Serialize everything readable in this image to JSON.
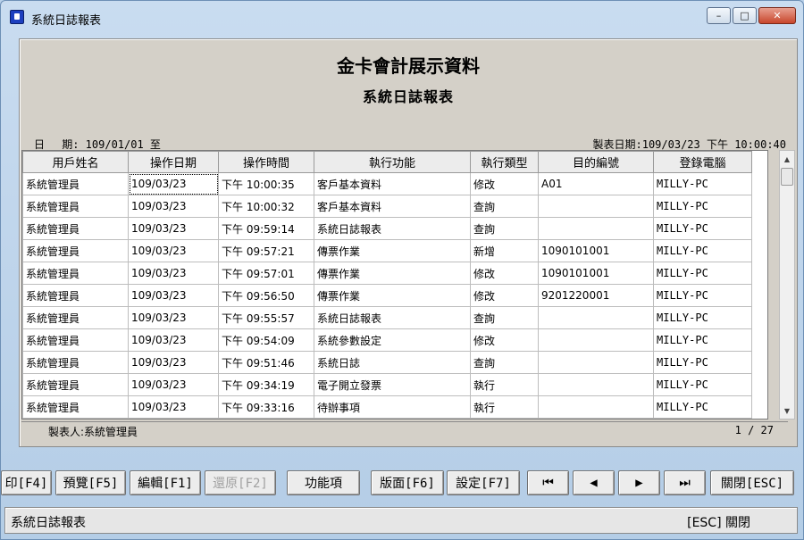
{
  "window": {
    "title": "系統日誌報表",
    "minimize_label": "–",
    "maximize_label": "□",
    "close_label": "✕"
  },
  "report": {
    "company": "金卡會計展示資料",
    "name": "系統日誌報表",
    "date_range": "日　 期: 109/01/01 至",
    "print_date": "製表日期:109/03/23 下午 10:00:40",
    "preparer": "製表人:系統管理員",
    "page": "1 / 27"
  },
  "table": {
    "columns": [
      "用戶姓名",
      "操作日期",
      "操作時間",
      "執行功能",
      "執行類型",
      "目的編號",
      "登錄電腦"
    ],
    "rows": [
      [
        "系統管理員",
        "109/03/23",
        "下午 10:00:35",
        "客戶基本資料",
        "修改",
        "A01",
        "MILLY-PC"
      ],
      [
        "系統管理員",
        "109/03/23",
        "下午 10:00:32",
        "客戶基本資料",
        "查詢",
        "",
        "MILLY-PC"
      ],
      [
        "系統管理員",
        "109/03/23",
        "下午 09:59:14",
        "系統日誌報表",
        "查詢",
        "",
        "MILLY-PC"
      ],
      [
        "系統管理員",
        "109/03/23",
        "下午 09:57:21",
        "傳票作業",
        "新增",
        "1090101001",
        "MILLY-PC"
      ],
      [
        "系統管理員",
        "109/03/23",
        "下午 09:57:01",
        "傳票作業",
        "修改",
        "1090101001",
        "MILLY-PC"
      ],
      [
        "系統管理員",
        "109/03/23",
        "下午 09:56:50",
        "傳票作業",
        "修改",
        "9201220001",
        "MILLY-PC"
      ],
      [
        "系統管理員",
        "109/03/23",
        "下午 09:55:57",
        "系統日誌報表",
        "查詢",
        "",
        "MILLY-PC"
      ],
      [
        "系統管理員",
        "109/03/23",
        "下午 09:54:09",
        "系統參數設定",
        "修改",
        "",
        "MILLY-PC"
      ],
      [
        "系統管理員",
        "109/03/23",
        "下午 09:51:46",
        "系統日誌",
        "查詢",
        "",
        "MILLY-PC"
      ],
      [
        "系統管理員",
        "109/03/23",
        "下午 09:34:19",
        "電子開立發票",
        "執行",
        "",
        "MILLY-PC"
      ],
      [
        "系統管理員",
        "109/03/23",
        "下午 09:33:16",
        "待辦事項",
        "執行",
        "",
        "MILLY-PC"
      ],
      [
        "",
        "",
        "",
        "",
        "",
        "",
        ""
      ]
    ]
  },
  "toolbar": {
    "print": "印[F4]",
    "preview": "預覽[F5]",
    "edit": "編輯[F1]",
    "restore": "還原[F2]",
    "functions": "功能項",
    "layout": "版面[F6]",
    "settings": "設定[F7]",
    "first": "⏮",
    "prev": "◀",
    "next": "▶",
    "last": "⏭",
    "close": "關閉[ESC]"
  },
  "status": {
    "left": "系統日誌報表",
    "right": "[ESC] 關閉"
  }
}
